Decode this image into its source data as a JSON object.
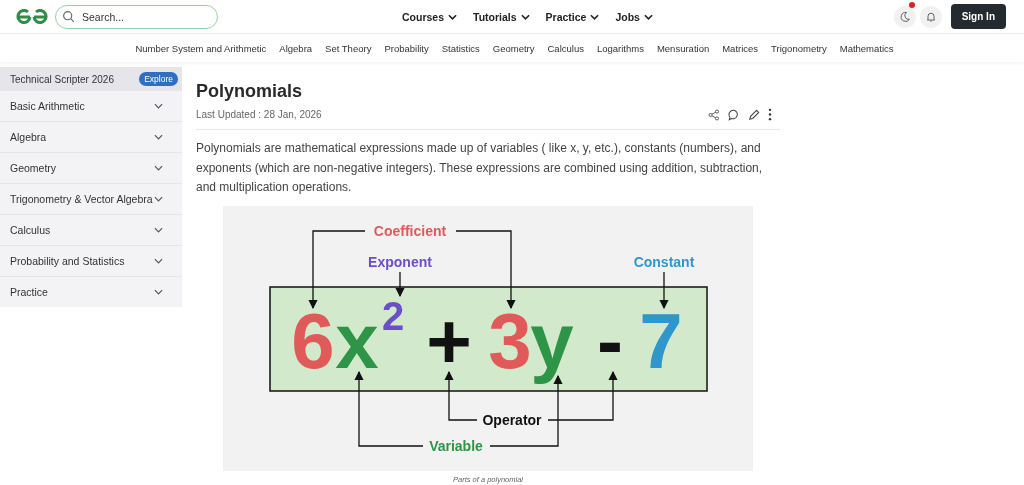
{
  "header": {
    "search": {
      "placeholder": "Search..."
    },
    "nav": [
      "Courses",
      "Tutorials",
      "Practice",
      "Jobs"
    ],
    "theme_toggle": {
      "notification": true
    },
    "sign_in": "Sign In"
  },
  "subnav": [
    "Number System and Arithmetic",
    "Algebra",
    "Set Theory",
    "Probability",
    "Statistics",
    "Geometry",
    "Calculus",
    "Logarithms",
    "Mensuration",
    "Matrices",
    "Trigonometry",
    "Mathematics"
  ],
  "sidebar": {
    "promo": {
      "label": "Technical Scripter 2026",
      "badge": "Explore"
    },
    "items": [
      "Basic Arithmetic",
      "Algebra",
      "Geometry",
      "Trigonometry & Vector Algebra",
      "Calculus",
      "Probability and Statistics",
      "Practice"
    ]
  },
  "article": {
    "title": "Polynomials",
    "updated": "Last Updated : 28 Jan, 2026",
    "intro": "Polynomials are mathematical expressions made up of variables ( like x, y, etc.), constants (numbers), and exponents (which are non-negative integers). These expressions are combined using addition, subtraction, and multiplication operations.",
    "figure": {
      "terms": [
        {
          "text": "6",
          "color": "#e05a5a",
          "kind": "base"
        },
        {
          "text": "x",
          "color": "#2e9447",
          "kind": "base"
        },
        {
          "text": "2",
          "color": "#6a4fc9",
          "kind": "exponent"
        },
        {
          "text": "+",
          "color": "#111111",
          "kind": "base"
        },
        {
          "text": "3",
          "color": "#e05a5a",
          "kind": "base"
        },
        {
          "text": "y",
          "color": "#2e9447",
          "kind": "base"
        },
        {
          "text": "-",
          "color": "#111111",
          "kind": "base"
        },
        {
          "text": "7",
          "color": "#2f97c9",
          "kind": "base"
        }
      ],
      "labels": [
        {
          "text": "Coefficient",
          "color": "#e05a5a"
        },
        {
          "text": "Exponent",
          "color": "#6a4fc9"
        },
        {
          "text": "Constant",
          "color": "#2f97c9"
        },
        {
          "text": "Operator",
          "color": "#111111"
        },
        {
          "text": "Variable",
          "color": "#2e9447"
        }
      ],
      "caption": "Parts of a polynomial"
    }
  }
}
